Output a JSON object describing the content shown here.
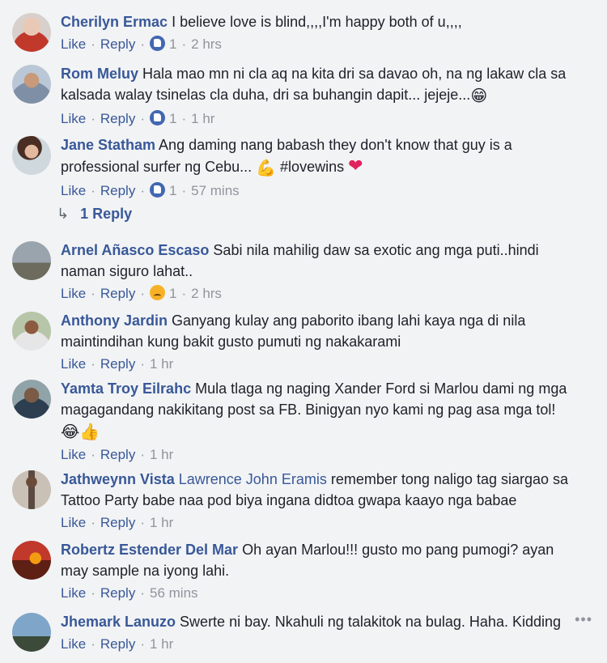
{
  "labels": {
    "like": "Like",
    "reply": "Reply",
    "more": "•••"
  },
  "comments": [
    {
      "author": "Cherilyn Ermac",
      "text": " I believe love is blind,,,,I'm happy both of u,,,,",
      "emoji": "",
      "reaction": "like",
      "count": "1",
      "time": "2 hrs"
    },
    {
      "author": "Rom Meluy",
      "text": " Hala mao mn ni cla aq na kita dri sa davao oh, na ng lakaw cla sa kalsada walay tsinelas cla duha, dri sa buhangin dapit... jejeje...",
      "emoji": "😁",
      "reaction": "like",
      "count": "1",
      "time": "1 hr"
    },
    {
      "author": "Jane Statham",
      "text": " Ang daming nang babash they don't know that guy is a professional surfer ng Cebu... ",
      "emoji": "💪",
      "tail": " #lovewins ",
      "heart": "❤",
      "reaction": "like",
      "count": "1",
      "time": "57 mins"
    },
    {
      "author": "Arnel Añasco Escaso",
      "text": " Sabi nila mahilig daw sa exotic ang mga puti..hindi naman siguro lahat..",
      "emoji": "",
      "reaction": "sad",
      "count": "1",
      "time": "2 hrs"
    },
    {
      "author": "Anthony Jardin",
      "text": " Ganyang kulay ang paborito ibang lahi kaya nga di nila maintindihan kung bakit gusto pumuti ng nakakarami",
      "emoji": "",
      "reaction": "",
      "count": "",
      "time": "1 hr"
    },
    {
      "author": "Yamta Troy Eilrahc",
      "text": " Mula tlaga ng naging Xander Ford si Marlou dami ng mga magagandang nakikitang post sa FB. Binigyan nyo kami ng pag asa mga tol!",
      "emoji": "😂👍",
      "reaction": "",
      "count": "",
      "time": "1 hr"
    },
    {
      "author": "Jathweynn Vista",
      "mention": "Lawrence John Eramis",
      "text": " remember tong naligo tag siargao sa Tattoo Party babe naa pod biya ingana didtoa gwapa kaayo nga babae",
      "emoji": "",
      "reaction": "",
      "count": "",
      "time": "1 hr"
    },
    {
      "author": "Robertz Estender Del Mar",
      "text": " Oh ayan Marlou!!! gusto mo pang pumogi? ayan may sample na iyong lahi.",
      "emoji": "",
      "reaction": "",
      "count": "",
      "time": "56 mins"
    },
    {
      "author": "Jhemark Lanuzo",
      "text": " Swerte ni bay. Nkahuli ng talakitok na bulag. Haha. Kidding",
      "emoji": "",
      "reaction": "",
      "count": "",
      "time": "1 hr"
    }
  ],
  "replies": {
    "label": "1 Reply"
  },
  "colors": {
    "link": "#385898",
    "meta": "#90949c",
    "background": "#f2f3f5",
    "like": "#4267b2"
  }
}
